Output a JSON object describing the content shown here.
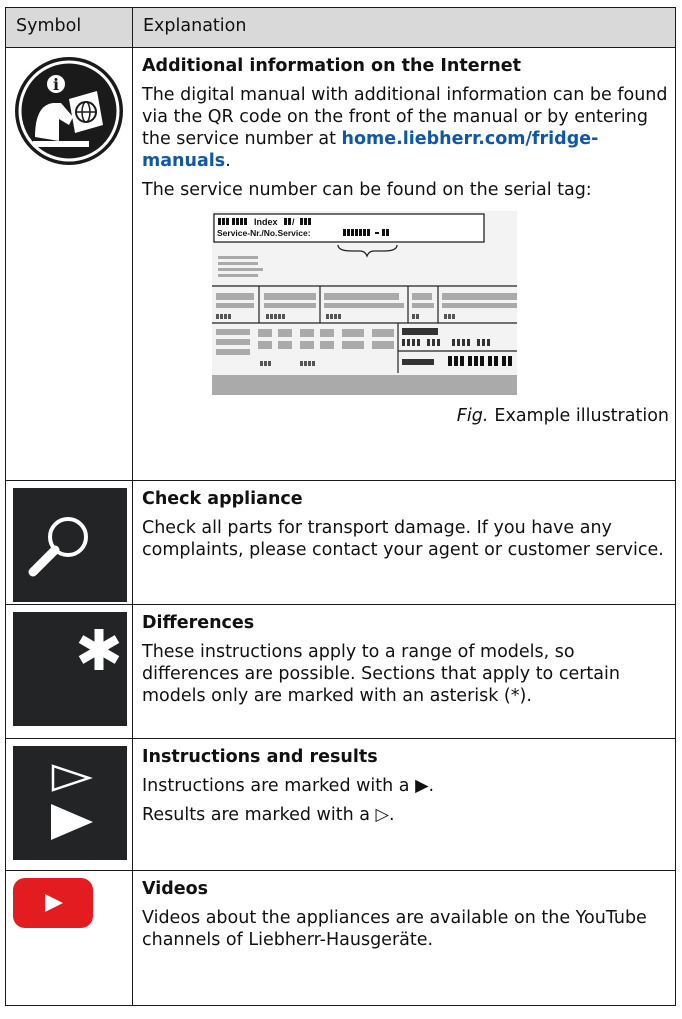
{
  "header": {
    "symbol": "Symbol",
    "explanation": "Explanation"
  },
  "rows": [
    {
      "icon": "internet-manual-icon",
      "title": "Additional information on the Internet",
      "p1_before": "The digital manual with additional information can be found via the QR code on the front of the manual or by entering the service number at ",
      "p1_link": "home.liebherr.com/fridge-manuals",
      "p1_after": ".",
      "p2": "The service number can be found on the serial tag:",
      "tag_index": "Index",
      "tag_service": "Service-Nr./No.Service:",
      "fig_label": "Fig.",
      "fig_caption": "Example illustration"
    },
    {
      "icon": "magnifier-icon",
      "title": "Check appliance",
      "body": "Check all parts for transport damage. If you have any complaints, please contact your agent or customer service."
    },
    {
      "icon": "asterisk-icon",
      "title": "Differences",
      "body": "These instructions apply to a range of models, so differences are possible. Sections that apply to certain models only are marked with an asterisk (*)."
    },
    {
      "icon": "triangle-arrows-icon",
      "title": "Instructions and results",
      "line1": "Instructions are marked with a ▶.",
      "line2": "Results are marked with a ▷."
    },
    {
      "icon": "youtube-icon",
      "title": "Videos",
      "body": "Videos about the appliances are available on the YouTube channels of Liebherr-Hausgeräte."
    }
  ],
  "colors": {
    "youtube_red": "#e31c1f",
    "link_blue": "#0f58a8",
    "icon_dark": "#222426"
  }
}
